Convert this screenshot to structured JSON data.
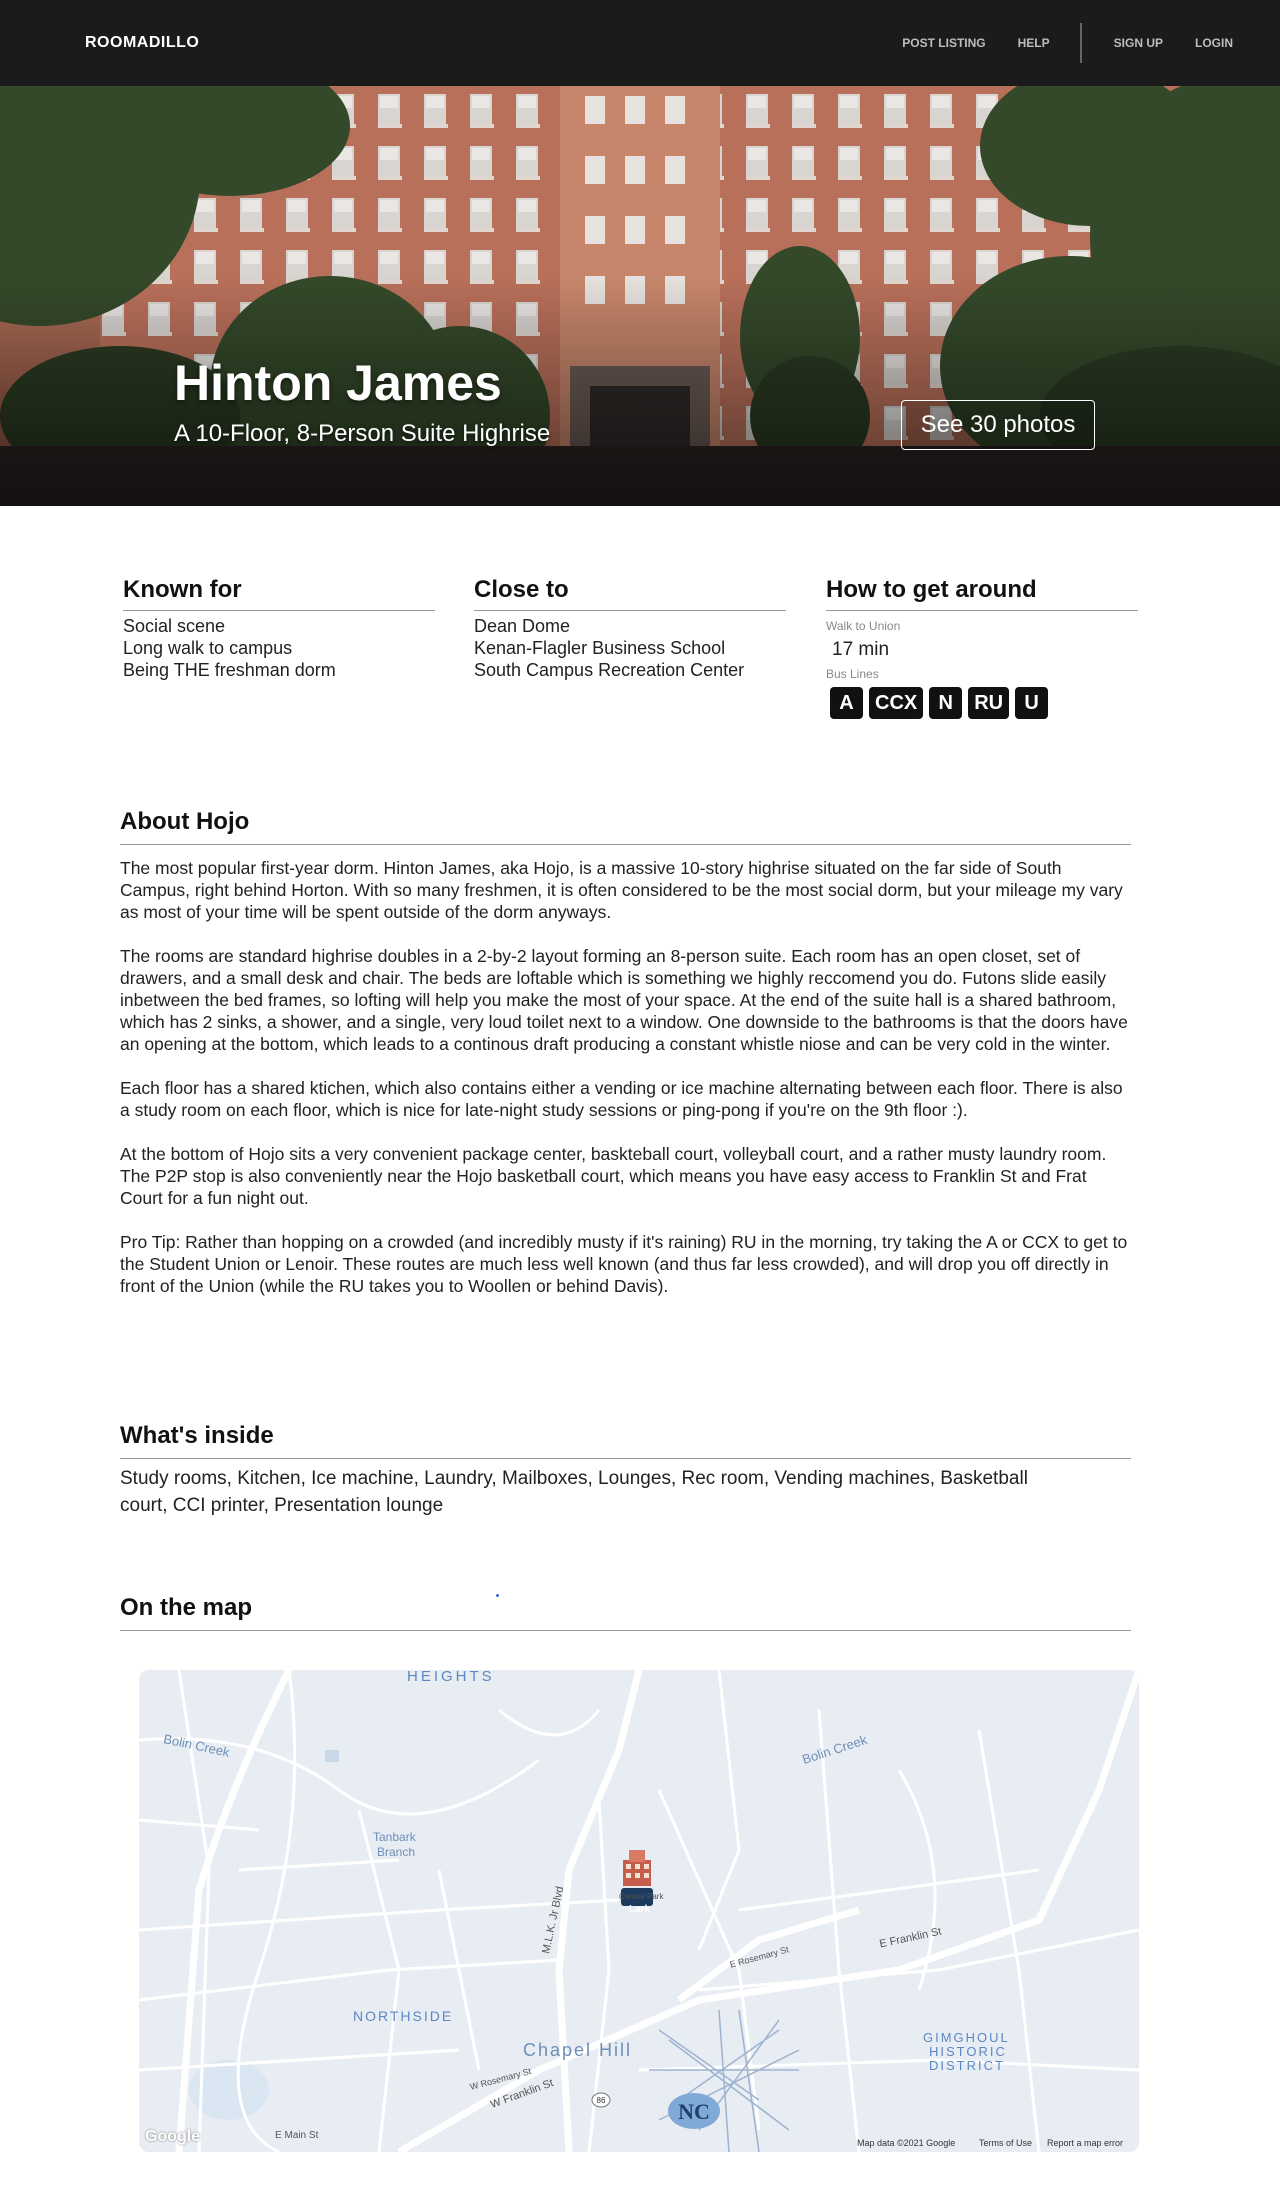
{
  "nav": {
    "logo": "ROOMADILLO",
    "links": [
      "POST LISTING",
      "HELP",
      "SIGN UP",
      "LOGIN"
    ]
  },
  "hero": {
    "title": "Hinton James",
    "subtitle": "A 10-Floor, 8-Person Suite Highrise",
    "photos_button": "See 30 photos"
  },
  "known_for": {
    "heading": "Known for",
    "items": [
      "Social scene",
      "Long walk to campus",
      "Being THE freshman dorm"
    ]
  },
  "close_to": {
    "heading": "Close to",
    "items": [
      "Dean Dome",
      "Kenan-Flagler Business School",
      "South Campus Recreation Center"
    ]
  },
  "get_around": {
    "heading": "How to get around",
    "walk_label": "Walk to Union",
    "walk_value": "17 min",
    "bus_label": "Bus Lines",
    "buses": [
      "A",
      "CCX",
      "N",
      "RU",
      "U"
    ]
  },
  "about": {
    "heading": "About Hojo",
    "paragraphs": [
      "The most popular first-year dorm. Hinton James, aka Hojo, is a massive 10-story highrise situated on the far side of South Campus, right behind Horton. With so many freshmen, it is often considered to be the most social dorm, but your mileage my vary as most of your time will be spent outside of the dorm anyways.",
      "The rooms are standard highrise doubles in a 2-by-2 layout forming an 8-person suite. Each room has an open closet, set of drawers, and a small desk and chair. The beds are loftable which is something we highly reccomend you do. Futons slide easily inbetween the bed frames, so lofting will help you make the most of your space. At the end of the suite hall is a shared bathroom, which has 2 sinks, a shower, and a single, very loud toilet next to a window. One downside to the bathrooms is that the doors have an opening at the bottom, which leads to a continous draft producing a constant whistle niose and can be very cold in the winter.",
      "Each floor has a shared ktichen, which also contains either a vending or ice machine alternating between each floor. There is also a study room on each floor, which is nice for late-night study sessions or ping-pong if you're on the 9th floor :).",
      "At the bottom of Hojo sits a very convenient package center, baskteball court, volleyball court, and a rather musty laundry room. The P2P stop is also conveniently near the Hojo basketball court, which means you have easy access to Franklin St and Frat Court for a fun night out.",
      "Pro Tip: Rather than hopping on a crowded (and incredibly musty if it's raining) RU in the morning, try taking the A or CCX to get to the Student Union or Lenoir. These routes are much less well known (and thus far less crowded), and will drop you off directly in front of the Union (while the RU takes you to Woollen or behind Davis)."
    ]
  },
  "inside": {
    "heading": "What's inside",
    "text": "Study rooms, Kitchen, Ice machine, Laundry, Mailboxes, Lounges, Rec room, Vending machines, Basketball court, CCI printer, Presentation lounge"
  },
  "map": {
    "heading": "On the map",
    "labels": {
      "heights": "HEIGHTS",
      "northside": "NORTHSIDE",
      "chapel_hill": "Chapel Hill",
      "gimghoul": "GIMGHOUL",
      "historic": "HISTORIC",
      "district": "DISTRICT",
      "bolin_creek_w": "Bolin Creek",
      "bolin_creek_e": "Bolin Creek",
      "tanbark": "Tanbark",
      "branch": "Branch",
      "e_franklin": "E Franklin St",
      "w_franklin": "W Franklin St",
      "mlk": "M.L.K. Jr Blvd",
      "e_rosemary": "E Rosemary St",
      "w_rosemary": "W Rosemary St",
      "e_main": "E Main St",
      "central_park": "Central Park",
      "marker_label": "Lark",
      "google": "Google",
      "map_data": "Map data ©2021 Google",
      "terms": "Terms of Use",
      "report": "Report a map error"
    }
  }
}
